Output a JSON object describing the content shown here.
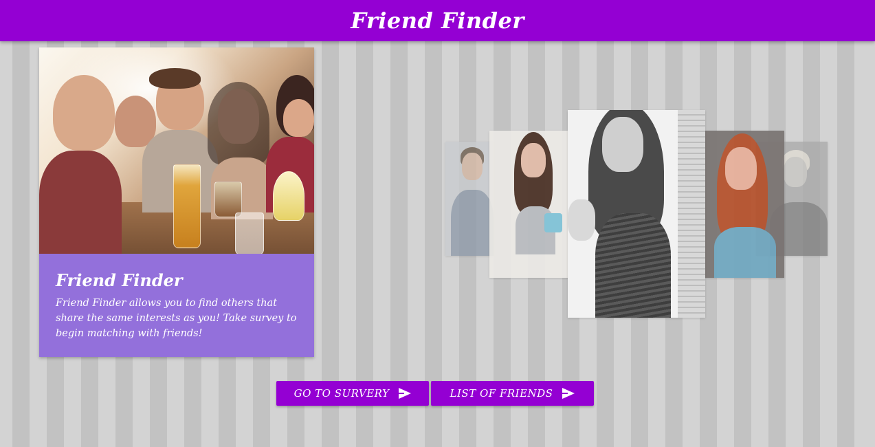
{
  "navbar": {
    "brand": "Friend Finder"
  },
  "card": {
    "image_alt": "Group of friends toasting drinks",
    "title": "Friend Finder",
    "description": "Friend Finder allows you to find others that share the same interests as you! Take survey to begin matching with friends!"
  },
  "carousel": {
    "items": [
      {
        "name": "profile-photo-1"
      },
      {
        "name": "profile-photo-2"
      },
      {
        "name": "profile-photo-3"
      },
      {
        "name": "profile-photo-4"
      },
      {
        "name": "profile-photo-5"
      }
    ],
    "active_index": 2
  },
  "buttons": {
    "survey_label": "Go to Survery",
    "friends_label": "List of Friends",
    "icon": "send-icon"
  },
  "colors": {
    "primary": "#9400d3",
    "card_body": "#9370db",
    "stripe_light": "#d3d3d3",
    "stripe_dark": "#c2c2c2"
  }
}
